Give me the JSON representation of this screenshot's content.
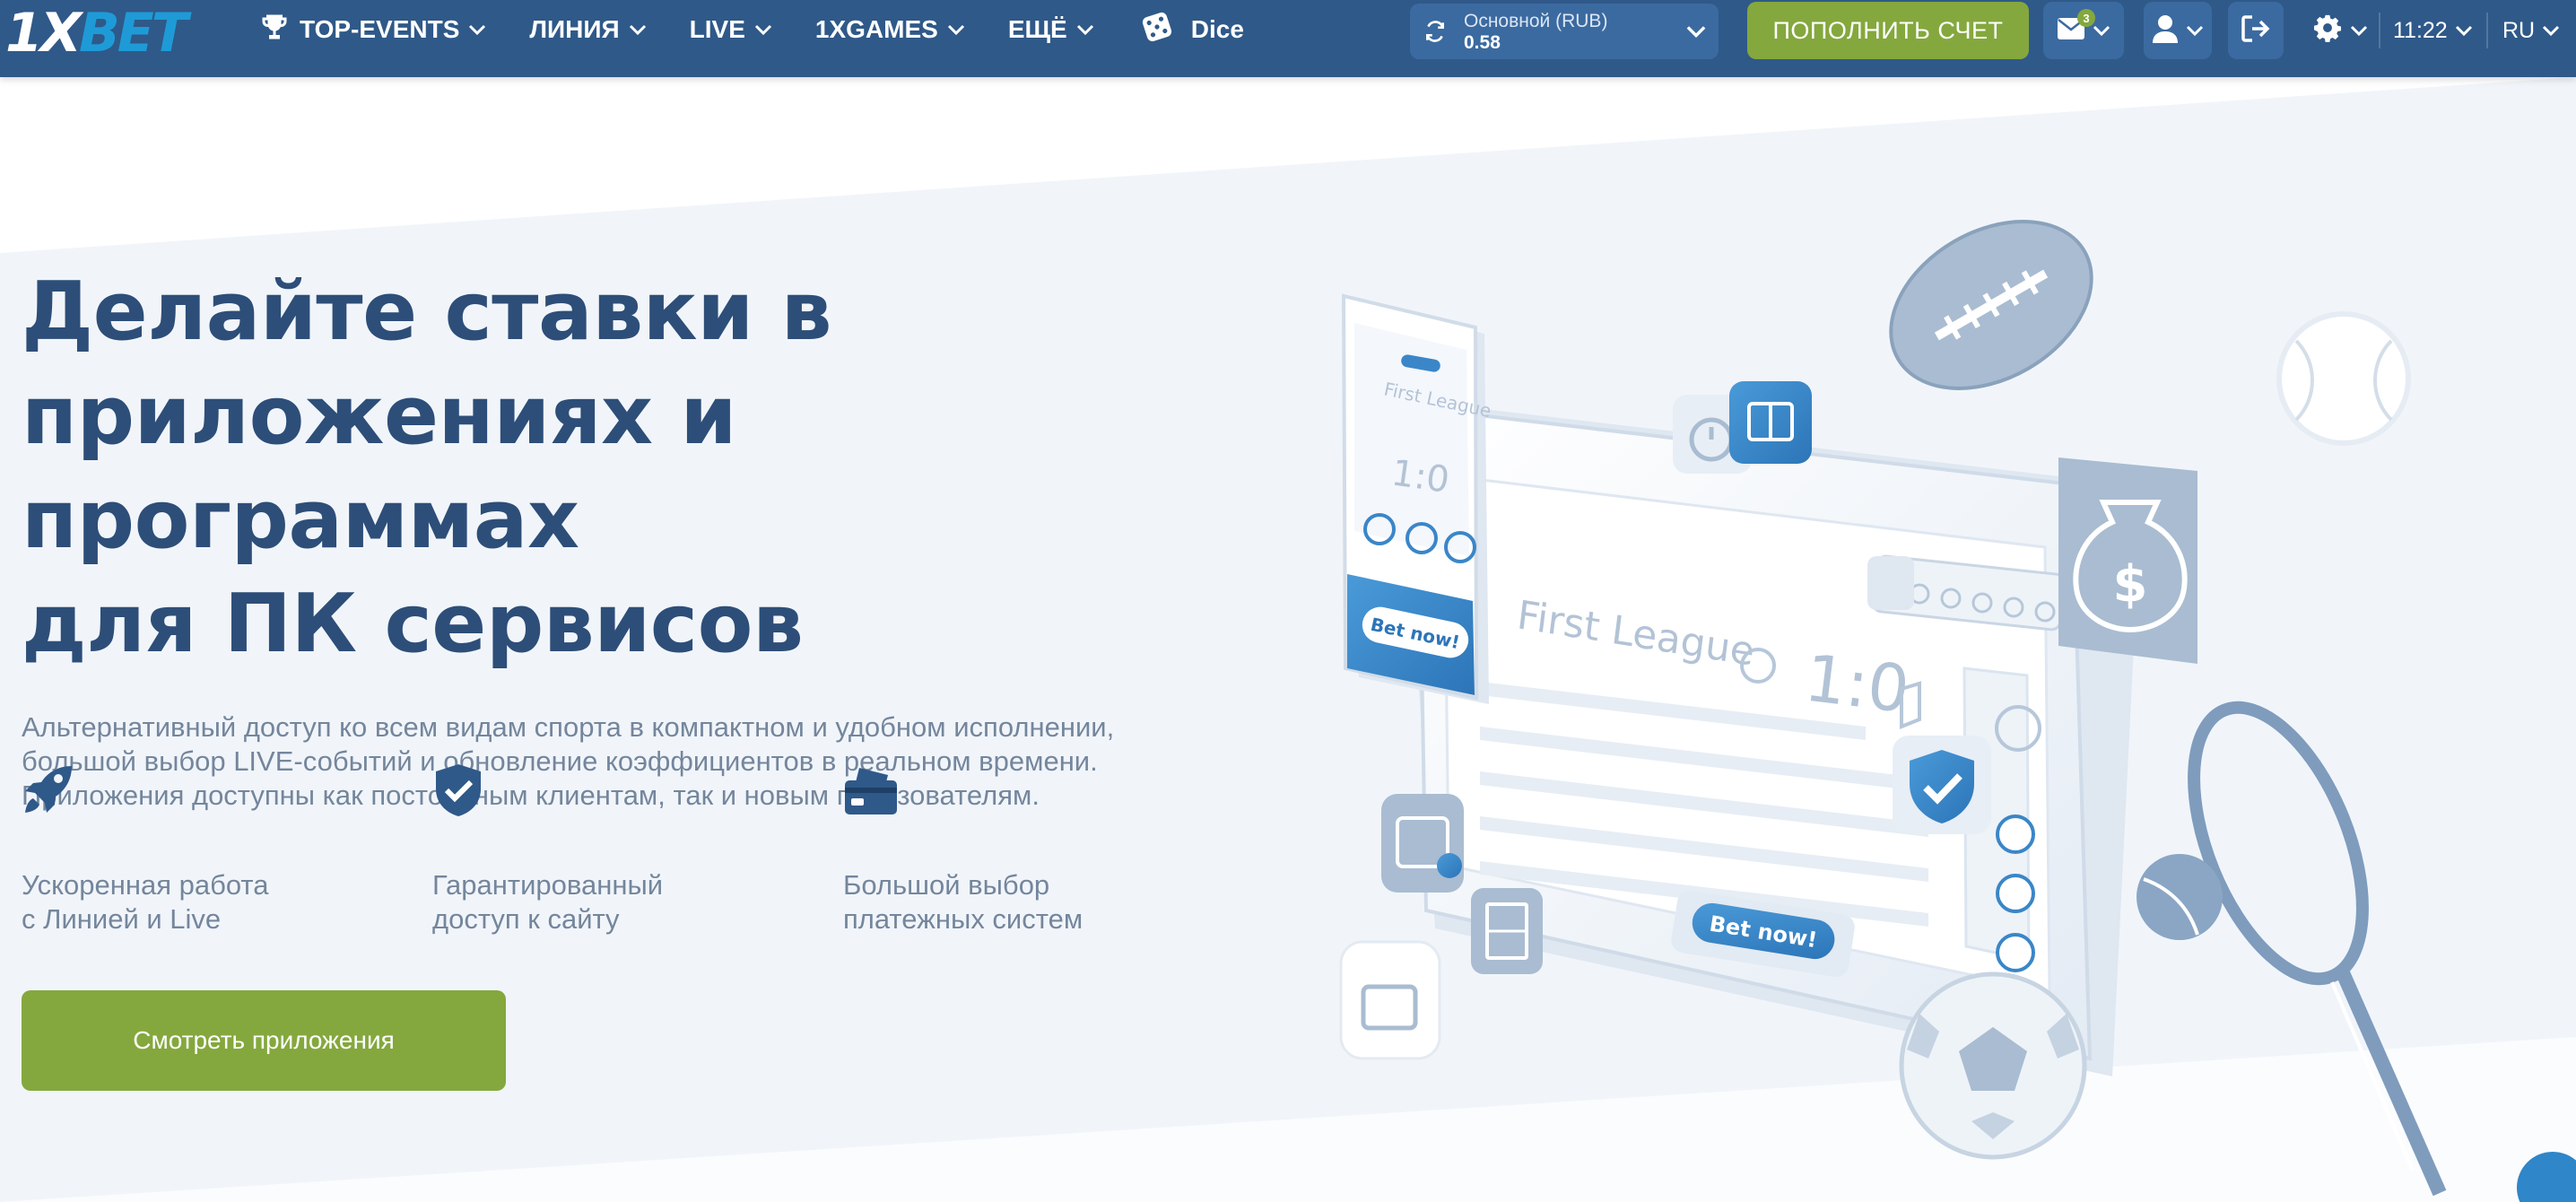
{
  "header": {
    "logo": {
      "part1": "1X",
      "part2": "BET"
    },
    "nav": [
      {
        "label": "TOP-EVENTS",
        "icon": "trophy-icon"
      },
      {
        "label": "ЛИНИЯ"
      },
      {
        "label": "LIVE"
      },
      {
        "label": "1XGAMES"
      },
      {
        "label": "ЕЩЁ"
      }
    ],
    "dice_label": "Dice",
    "balance": {
      "label": "Основной  (RUB)",
      "value": "0.58"
    },
    "deposit_label": "ПОПОЛНИТЬ СЧЕТ",
    "messages_count": "3",
    "time": "11:22",
    "language": "RU"
  },
  "hero": {
    "title_lines": [
      "Делайте ставки в",
      "приложениях и программах",
      "для ПК сервисов"
    ],
    "description_lines": [
      "Альтернативный доступ ко всем видам спорта в компактном и удобном исполнении,",
      "большой выбор LIVE-событий и обновление коэффициентов в реальном времени.",
      "Приложения доступны как постоянным клиентам, так и новым пользователям."
    ],
    "features": [
      {
        "icon": "rocket-icon",
        "line1": "Ускоренная работа",
        "line2": "с Линией и Live"
      },
      {
        "icon": "shield-check-icon",
        "line1": "Гарантированный",
        "line2": "доступ к сайту"
      },
      {
        "icon": "credit-card-icon",
        "line1": "Большой выбор",
        "line2": "платежных систем"
      }
    ],
    "cta_label": "Смотреть приложения"
  },
  "illustration": {
    "league_label": "First League",
    "score": "1:0",
    "bet_button": "Bet now!",
    "phone_score": "1:0",
    "phone_league": "First League",
    "phone_bet": "Bet now!"
  },
  "colors": {
    "header_bg": "#2f5989",
    "accent_green": "#84a83d",
    "title_blue": "#2d4e78",
    "text_gray": "#74869c"
  }
}
